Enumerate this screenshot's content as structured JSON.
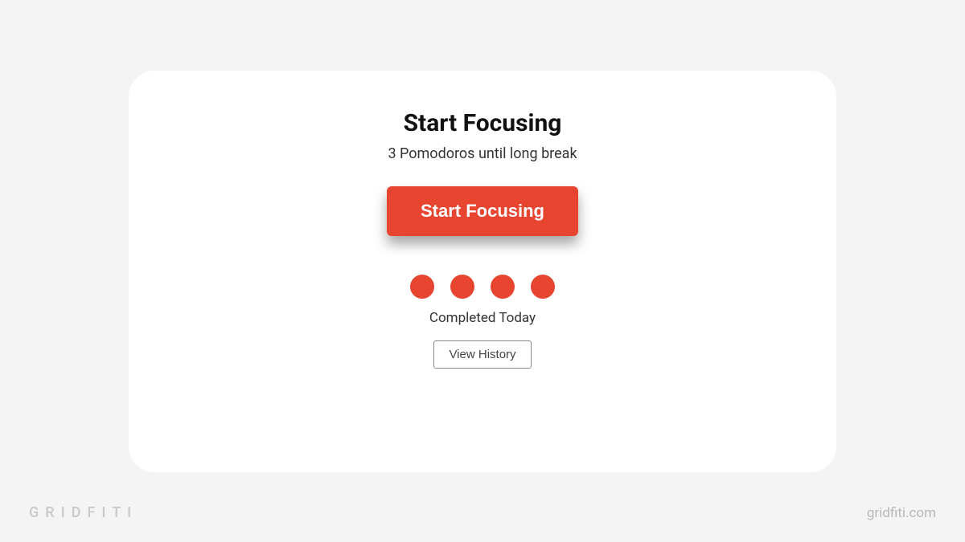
{
  "card": {
    "title": "Start Focusing",
    "subtitle": "3 Pomodoros until long break",
    "start_button_label": "Start Focusing",
    "completed_label": "Completed Today",
    "history_button_label": "View History",
    "pomodoro_dots": 4
  },
  "watermark": {
    "left": "GRIDFITI",
    "right": "gridfiti.com"
  },
  "colors": {
    "accent": "#e74530",
    "background": "#f4f4f4",
    "card_background": "#ffffff"
  }
}
